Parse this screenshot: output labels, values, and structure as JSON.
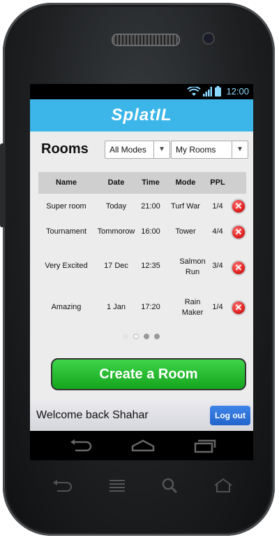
{
  "status_bar": {
    "time": "12:00"
  },
  "app": {
    "title": "SplatIL"
  },
  "rooms": {
    "title": "Rooms",
    "mode_filter": "All Modes",
    "owner_filter": "My Rooms",
    "columns": [
      "Name",
      "Date",
      "Time",
      "Mode",
      "PPL"
    ],
    "rows": [
      {
        "name": "Super room",
        "date": "Today",
        "time": "21:00",
        "mode": "Turf War",
        "ppl": "1/4"
      },
      {
        "name": "Tournament",
        "date": "Tommorow",
        "time": "16:00",
        "mode": "Tower",
        "ppl": "4/4"
      },
      {
        "name": "Very Excited",
        "date": "17 Dec",
        "time": "12:35",
        "mode": "Salmon Run",
        "ppl": "3/4"
      },
      {
        "name": "Amazing",
        "date": "1 Jan",
        "time": "17:20",
        "mode": "Rain Maker",
        "ppl": "1/4"
      }
    ],
    "delete_icon": "delete-x-icon"
  },
  "pagination": {
    "pages": 4,
    "current": 2
  },
  "create_button": "Create a Room",
  "footer": {
    "welcome": "Welcome back Shahar",
    "logout": "Log out"
  },
  "colors": {
    "app_bar": "#3cb6e8",
    "create_button": "#22b52b",
    "logout_button": "#2f76dc",
    "delete": "#e02020"
  }
}
